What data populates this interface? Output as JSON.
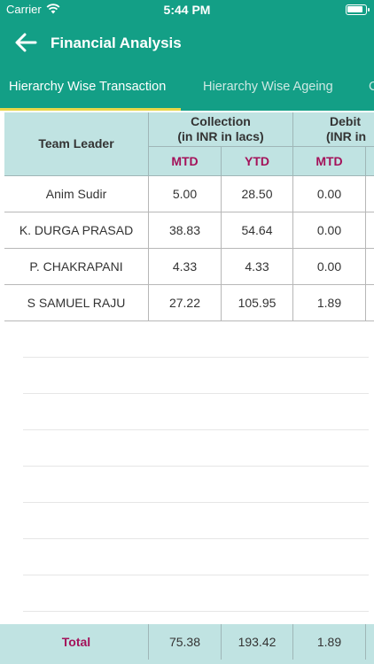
{
  "status_bar": {
    "carrier": "Carrier",
    "time": "5:44 PM"
  },
  "header": {
    "title": "Financial Analysis"
  },
  "tabs": [
    {
      "label": "Hierarchy Wise Transaction",
      "selected": true
    },
    {
      "label": "Hierarchy Wise Ageing",
      "selected": false
    },
    {
      "label": "C",
      "selected": false
    }
  ],
  "table": {
    "leader_header": "Team Leader",
    "groups": [
      {
        "title": "Collection",
        "unit": "(in INR in lacs)"
      },
      {
        "title": "Debit",
        "unit": "(INR in"
      }
    ],
    "sub_headers": [
      "MTD",
      "YTD",
      "MTD"
    ],
    "rows": [
      {
        "leader": "Anim Sudir",
        "values": [
          "5.00",
          "28.50",
          "0.00"
        ]
      },
      {
        "leader": "K. DURGA PRASAD",
        "values": [
          "38.83",
          "54.64",
          "0.00"
        ]
      },
      {
        "leader": "P. CHAKRAPANI",
        "values": [
          "4.33",
          "4.33",
          "0.00"
        ]
      },
      {
        "leader": "S SAMUEL RAJU",
        "values": [
          "27.22",
          "105.95",
          "1.89"
        ]
      }
    ]
  },
  "footer": {
    "label": "Total",
    "values": [
      "75.38",
      "193.42",
      "1.89"
    ]
  },
  "colors": {
    "primary": "#139f86",
    "header_bg": "#c0e3e2",
    "accent_text": "#a4125a",
    "tab_indicator": "#e9d749"
  }
}
